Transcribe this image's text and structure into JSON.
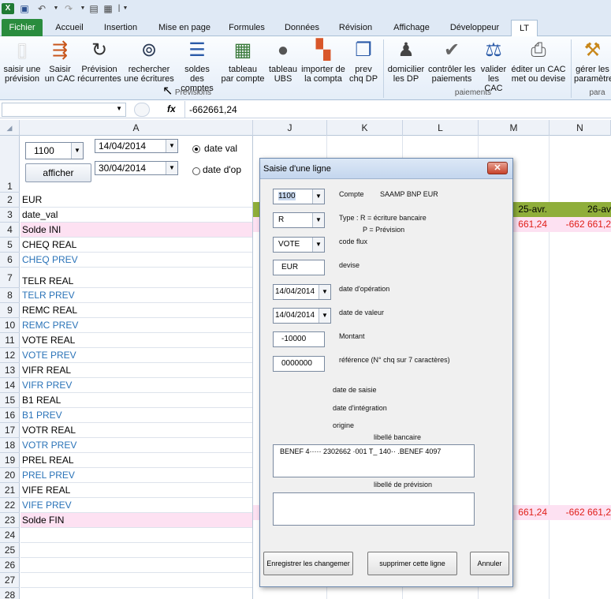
{
  "qat": {
    "separator": "|",
    "chevron": "▼"
  },
  "tabs": [
    "Fichier",
    "Accueil",
    "Insertion",
    "Mise en page",
    "Formules",
    "Données",
    "Révision",
    "Affichage",
    "Développeur",
    "LT"
  ],
  "ribbon": {
    "groups": {
      "previsions": "Prévisions",
      "paiements": "paiements",
      "parametres": "para"
    },
    "buttons": [
      {
        "label1": "saisir une",
        "label2": "prévision"
      },
      {
        "label1": "Saisir",
        "label2": "un CAC"
      },
      {
        "label1": "Prévision",
        "label2": "récurrentes"
      },
      {
        "label1": "rechercher",
        "label2": "une écritures"
      },
      {
        "label1": "soldes des",
        "label2": "comptes"
      },
      {
        "label1": "tableau",
        "label2": "par compte"
      },
      {
        "label1": "tableau",
        "label2": "UBS"
      },
      {
        "label1": "importer de",
        "label2": "la compta"
      },
      {
        "label1": "prev",
        "label2": "chq DP"
      },
      {
        "label1": "domicilier",
        "label2": "les DP"
      },
      {
        "label1": "contrôler les",
        "label2": "paiements"
      },
      {
        "label1": "valider",
        "label2": "les CAC"
      },
      {
        "label1": "éditer un CAC",
        "label2": "met ou devise"
      },
      {
        "label1": "gérer les",
        "label2": "paramètres"
      }
    ]
  },
  "formula_bar": {
    "fx": "fx",
    "value": "-662661,24"
  },
  "columns": [
    "A",
    "J",
    "K",
    "L",
    "M",
    "N"
  ],
  "rows": [
    "1",
    "2",
    "3",
    "4",
    "5",
    "6",
    "7",
    "8",
    "9",
    "10",
    "11",
    "12",
    "13",
    "14",
    "15",
    "16",
    "17",
    "18",
    "19",
    "20",
    "21",
    "22",
    "23",
    "24",
    "25",
    "26",
    "27",
    "28"
  ],
  "sheet": {
    "account_combo": "1100",
    "date_from": "14/04/2014",
    "date_to": "30/04/2014",
    "afficher": "afficher",
    "radio_val": "date val",
    "radio_op": "date d'op",
    "cells": [
      "EUR",
      "date_val",
      "Solde INI",
      "CHEQ REAL",
      "CHEQ PREV",
      "TELR REAL",
      "TELR PREV",
      "REMC REAL",
      "REMC PREV",
      "VOTE REAL",
      "VOTE PREV",
      "VIFR REAL",
      "VIFR PREV",
      "B1 REAL",
      "B1 PREV",
      "VOTR REAL",
      "VOTR PREV",
      "PREL REAL",
      "PREL PREV",
      "VIFE REAL",
      "VIFE PREV",
      "Solde FIN"
    ],
    "m3": "25-avr.",
    "n3": "26-av",
    "m4": "661,24",
    "n4": "-662 661,2",
    "m23": "661,24",
    "n23": "-662 661,2"
  },
  "dialog": {
    "title": "Saisie d'une ligne",
    "close": "✕",
    "compte_value": "1100",
    "compte_label": "Compte",
    "compte_name": "SAAMP BNP EUR",
    "type_value": "R",
    "type_label1": "Type : R = écriture bancaire",
    "type_label2": "P = Prévision",
    "flux_value": "VOTE",
    "flux_label": "code flux",
    "devise_value": "EUR",
    "devise_label": "devise",
    "date_op_value": "14/04/2014",
    "date_op_label": "date d'opération",
    "date_val_value": "14/04/2014",
    "date_val_label": "date de valeur",
    "montant_value": "-10000",
    "montant_label": "Montant",
    "ref_value": "0000000",
    "ref_label": "référence (N° chq sur 7 caractères)",
    "date_saisie_label": "date de saisie",
    "date_integration_label": "date d'intégration",
    "origine_label": "origine",
    "libelle_bancaire_label": "libellé bancaire",
    "libelle_bancaire_value": "BENEF  4·····     2302662      ·001 T_     140·· .BENEF 4097",
    "libelle_prevision_label": "libellé de prévision",
    "libelle_prevision_value": "",
    "btn_save": "Enregistrer les changemer",
    "btn_delete": "supprimer cette ligne",
    "btn_cancel": "Annuler"
  }
}
